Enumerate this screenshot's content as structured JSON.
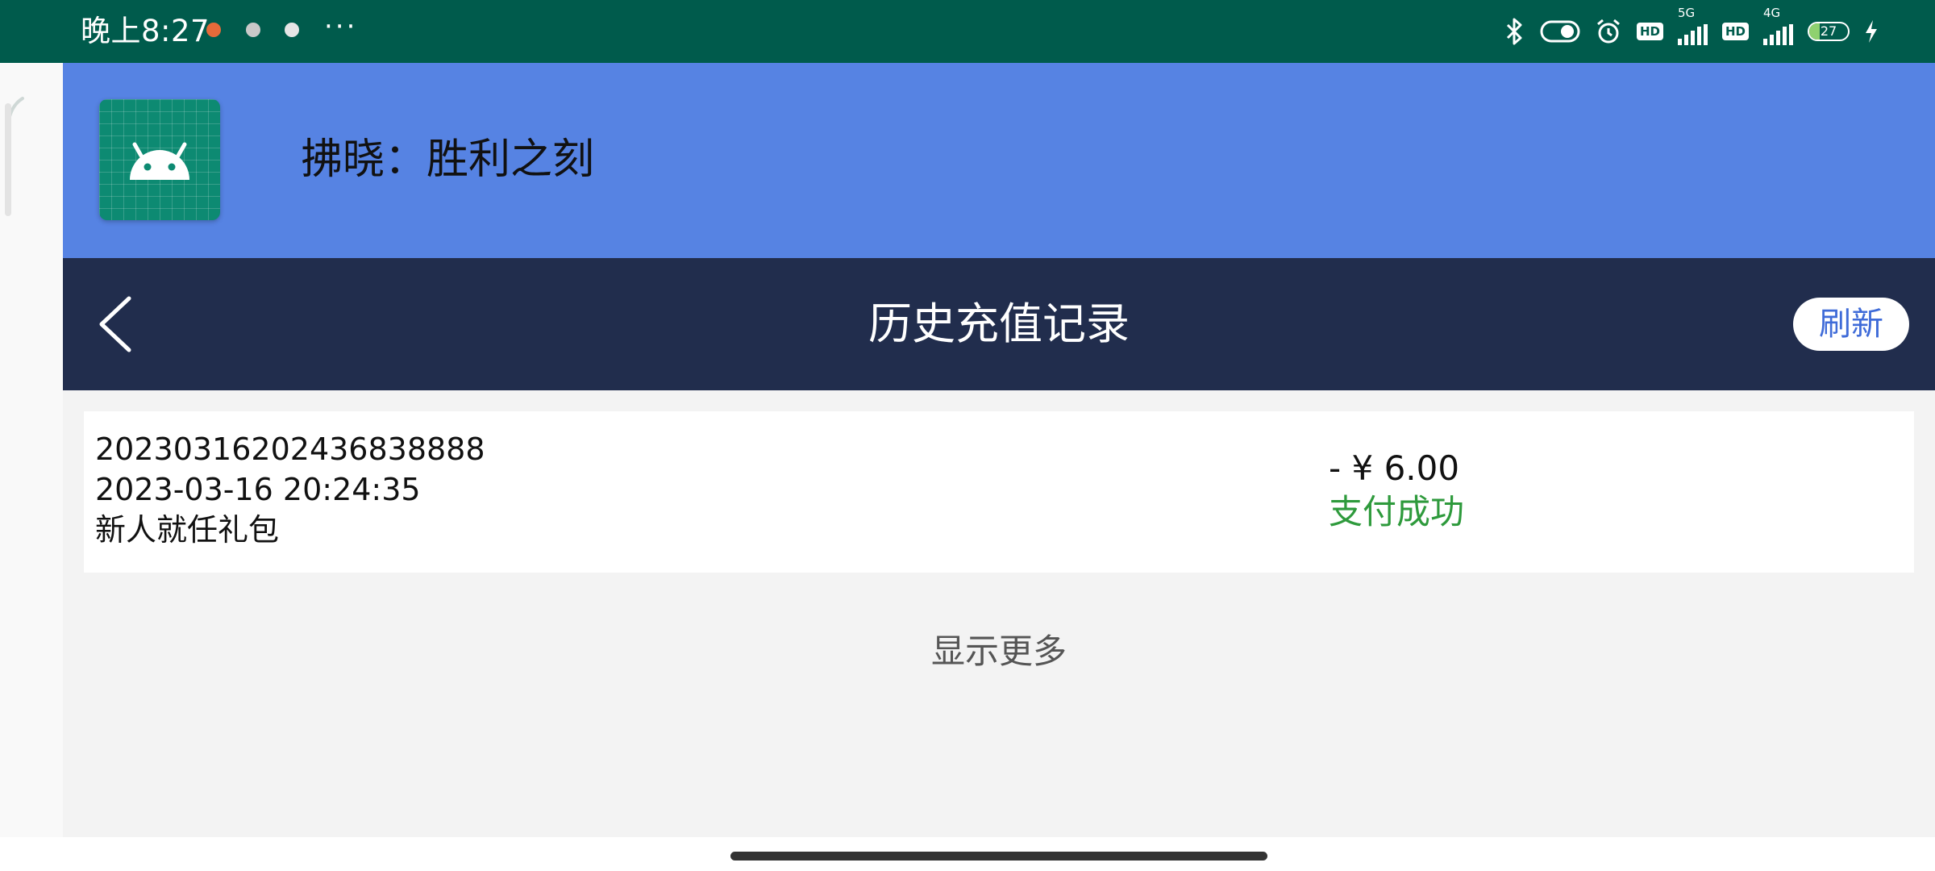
{
  "status_bar": {
    "time": "晚上8:27",
    "more": "···",
    "notification_icons": [
      "app-notification-icon",
      "app-notification-icon",
      "app-notification-icon"
    ],
    "right_icons": [
      "bluetooth-icon",
      "toggle-icon",
      "alarm-icon",
      "hd-badge",
      "5g-signal-icon",
      "hd-badge",
      "4g-signal-icon",
      "battery-icon",
      "charging-icon"
    ],
    "hd_label_1": "HD",
    "net_1": "5G",
    "hd_label_2": "HD",
    "net_2": "4G",
    "battery_level": "27",
    "battery_fraction": 0.27
  },
  "app_header": {
    "icon": "android-app-icon",
    "title": "拂晓：胜利之刻",
    "colors": {
      "background": "#5683e3"
    }
  },
  "nav": {
    "title": "历史充值记录",
    "refresh_label": "刷新",
    "back_icon": "chevron-left-icon",
    "colors": {
      "background": "#212d4d"
    }
  },
  "records": [
    {
      "order_id": "20230316202436838888",
      "datetime": "2023-03-16 20:24:35",
      "product": "新人就任礼包",
      "amount": "- ¥ 6.00",
      "status": "支付成功",
      "status_color": "#2e9a3c"
    }
  ],
  "show_more_label": "显示更多"
}
